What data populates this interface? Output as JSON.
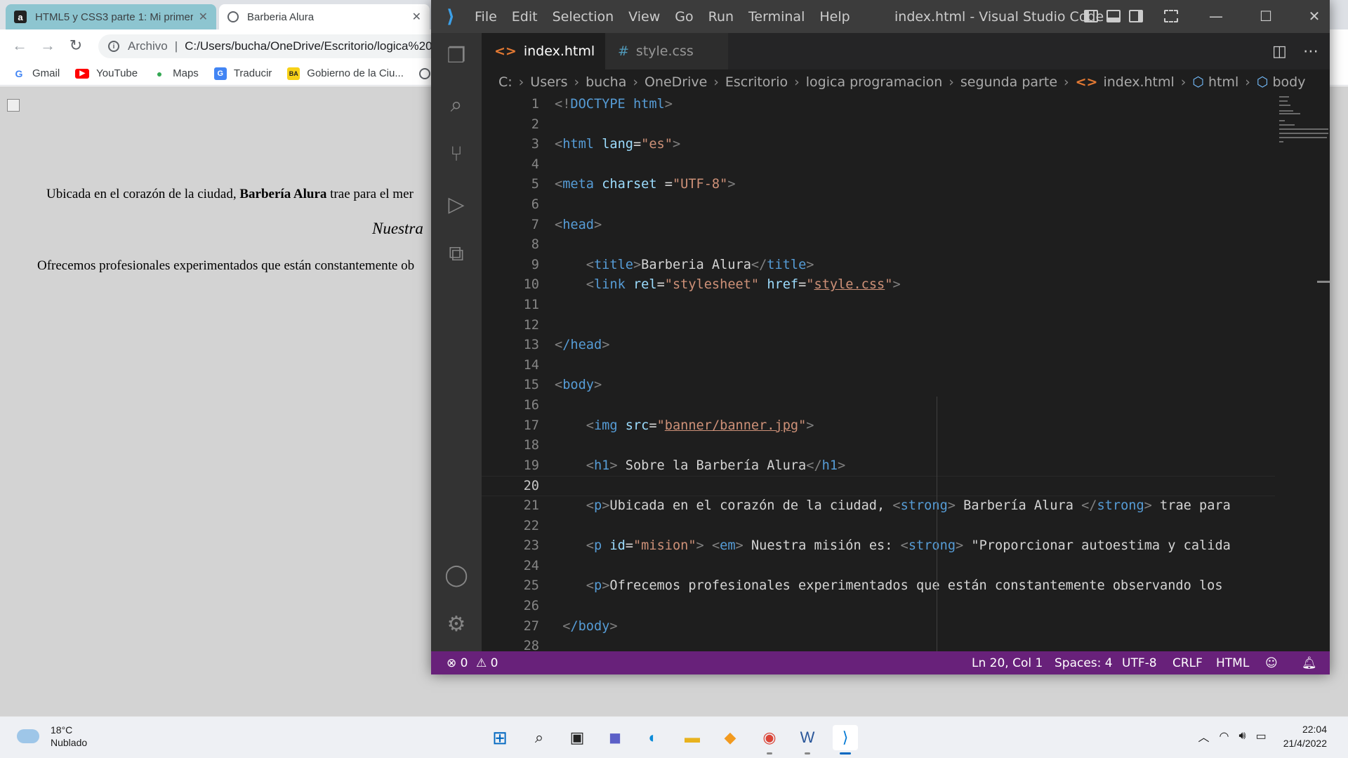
{
  "browser": {
    "tabs": [
      {
        "title": "HTML5 y CSS3 parte 1: Mi primer...",
        "close": "✕"
      },
      {
        "title": "Barberia Alura",
        "close": "✕"
      }
    ],
    "address": {
      "scheme_label": "Archivo",
      "url": "C:/Users/bucha/OneDrive/Escritorio/logica%20"
    },
    "bookmarks": [
      {
        "label": "Gmail",
        "icon": "G"
      },
      {
        "label": "YouTube",
        "icon": "▶"
      },
      {
        "label": "Maps",
        "icon": "●"
      },
      {
        "label": "Traducir",
        "icon": "G"
      },
      {
        "label": "Gobierno de la Ciu...",
        "icon": "BA"
      }
    ],
    "page": {
      "p1_before": "Ubicada en el corazón de la ciudad, ",
      "p1_strong": "Barbería Alura",
      "p1_after": " trae para el mer",
      "p2": "Nuestra",
      "p3": "Ofrecemos profesionales experimentados que están constantemente ob"
    }
  },
  "vscode": {
    "menu": [
      "File",
      "Edit",
      "Selection",
      "View",
      "Go",
      "Run",
      "Terminal",
      "Help"
    ],
    "window_title": "index.html - Visual Studio Code",
    "tabs": [
      {
        "label": "index.html",
        "icon": "<>",
        "close": "✕"
      },
      {
        "label": "style.css",
        "icon": "#"
      }
    ],
    "breadcrumbs": [
      "C:",
      "Users",
      "bucha",
      "OneDrive",
      "Escritorio",
      "logica programacion",
      "segunda parte",
      "index.html",
      "html",
      "body"
    ],
    "lines": [
      {
        "n": "1"
      },
      {
        "n": "2"
      },
      {
        "n": "3"
      },
      {
        "n": "4"
      },
      {
        "n": "5"
      },
      {
        "n": "6"
      },
      {
        "n": "7"
      },
      {
        "n": "8"
      },
      {
        "n": "9"
      },
      {
        "n": "10"
      },
      {
        "n": "11"
      },
      {
        "n": "12"
      },
      {
        "n": "13"
      },
      {
        "n": "14"
      },
      {
        "n": "15"
      },
      {
        "n": "16"
      },
      {
        "n": "17"
      },
      {
        "n": "18"
      },
      {
        "n": "19"
      },
      {
        "n": "20"
      },
      {
        "n": "21"
      },
      {
        "n": "22"
      },
      {
        "n": "23"
      },
      {
        "n": "24"
      },
      {
        "n": "25"
      },
      {
        "n": "26"
      },
      {
        "n": "27"
      },
      {
        "n": "28"
      }
    ],
    "code": {
      "l1": "DOCTYPE html",
      "l3_tag": "html",
      "l3_attr": "lang",
      "l3_val": "\"es\"",
      "l5_tag": "meta",
      "l5_attr": "charset",
      "l5_val": "\"UTF-8\"",
      "l7": "head",
      "l9_tag": "title",
      "l9_text": "Barberia Alura",
      "l10_tag": "link",
      "l10_a1": "rel",
      "l10_v1": "\"stylesheet\"",
      "l10_a2": "href",
      "l10_v2": "style.css",
      "l13": "/head",
      "l15": "body",
      "l17_tag": "img",
      "l17_attr": "src",
      "l17_val": "banner/banner.jpg",
      "l19_tag": "h1",
      "l19_text": " Sobre la Barbería Alura",
      "l21_tag": "p",
      "l21_text1": "Ubicada en el corazón de la ciudad, ",
      "l21_strong": "strong",
      "l21_text2": " Barbería Alura ",
      "l21_text3": " trae para",
      "l23_tag": "p",
      "l23_attr": "id",
      "l23_val": "\"mision\"",
      "l23_em": "em",
      "l23_text1": " Nuestra misión es: ",
      "l23_strong": "strong",
      "l23_text2": " \"Proporcionar autoestima y calida",
      "l25_tag": "p",
      "l25_text": "Ofrecemos profesionales experimentados que están constantemente observando los",
      "l27": "/body"
    },
    "status": {
      "errors": "⊗ 0",
      "warnings": "⚠ 0",
      "position": "Ln 20, Col 1",
      "spaces": "Spaces: 4",
      "encoding": "UTF-8",
      "eol": "CRLF",
      "language": "HTML"
    },
    "colors": {
      "statusbar": "#68217a",
      "editor_bg": "#1e1e1e",
      "tag": "#569cd6",
      "attr": "#9cdcfe",
      "string": "#ce9178"
    }
  },
  "taskbar": {
    "weather": {
      "temp": "18°C",
      "condition": "Nublado"
    },
    "time": "22:04",
    "date": "21/4/2022"
  }
}
